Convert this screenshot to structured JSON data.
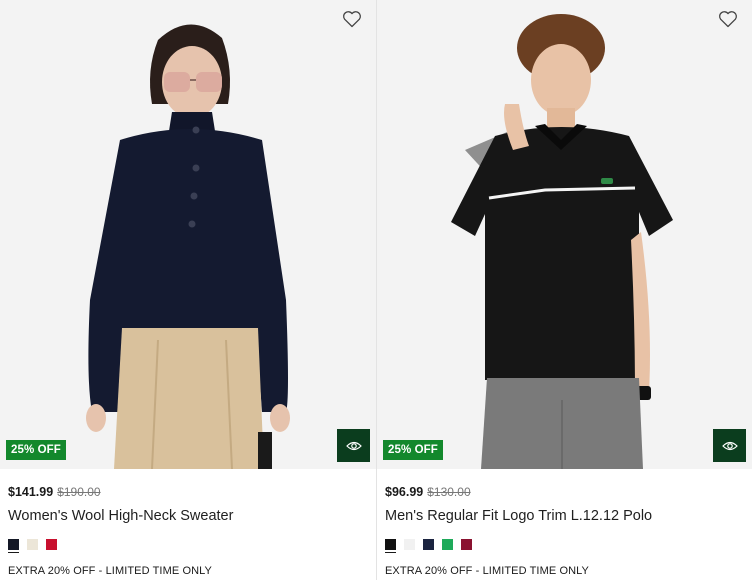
{
  "products": [
    {
      "badge": "25% OFF",
      "price": "$141.99",
      "original_price": "$190.00",
      "name": "Women's Wool High-Neck Sweater",
      "swatches": [
        "#141826",
        "#ece6d8",
        "#c8102e"
      ],
      "selected_swatch": 0,
      "promo": "EXTRA 20% OFF - LIMITED TIME ONLY"
    },
    {
      "badge": "25% OFF",
      "price": "$96.99",
      "original_price": "$130.00",
      "name": "Men's Regular Fit Logo Trim L.12.12 Polo",
      "swatches": [
        "#111111",
        "#f1f1f1",
        "#1b2440",
        "#1eaa5a",
        "#8a1230"
      ],
      "selected_swatch": 0,
      "promo": "EXTRA 20% OFF - LIMITED TIME ONLY"
    }
  ],
  "icons": {
    "wishlist": "heart-outline-icon",
    "quick_view": "eye-icon"
  },
  "colors": {
    "badge_green": "#13882c",
    "quickview_green": "#0b3d1e"
  }
}
